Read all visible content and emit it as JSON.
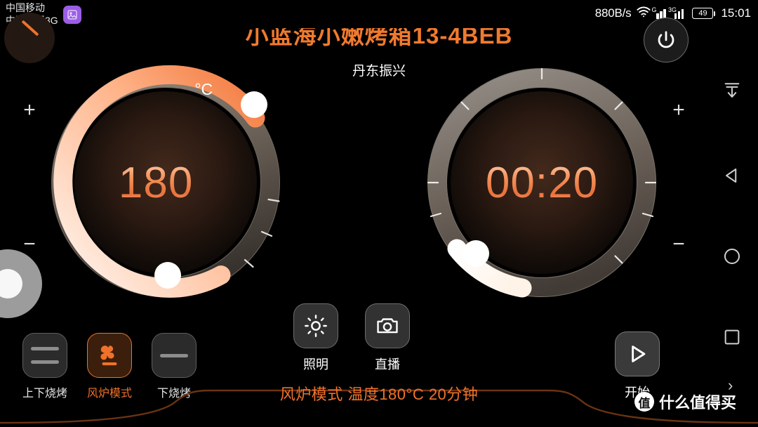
{
  "status_bar": {
    "carrier_line1": "中国移动",
    "carrier_line2": "中国联通3G",
    "app_badge_icon": "image-icon",
    "network_speed": "880B/s",
    "wifi_icon": "wifi-icon",
    "signal1_label": "G",
    "signal2_label": "3G",
    "battery_level": "49",
    "clock": "15:01"
  },
  "header": {
    "device_title": "小蓝海小嫩烤箱13-4BEB",
    "device_location": "丹东振兴",
    "power_icon": "power-icon",
    "title_color": "#f07a2e"
  },
  "temperature_dial": {
    "name": "temperature-dial",
    "value": "180",
    "unit": "°C",
    "increase_label": "+",
    "decrease_label": "−",
    "arc_color": "#f5835a",
    "progress_percent": 72
  },
  "timer_dial": {
    "name": "timer-dial",
    "value": "00:20",
    "increase_label": "+",
    "decrease_label": "−",
    "arc_color": "#ffffff",
    "progress_percent": 8
  },
  "center_actions": [
    {
      "id": "light",
      "label": "照明",
      "icon": "light-bulb-icon"
    },
    {
      "id": "live",
      "label": "直播",
      "icon": "camera-icon"
    }
  ],
  "modes": [
    {
      "id": "top-bottom-grill",
      "label": "上下烧烤",
      "icon": "two-bars-icon",
      "active": false
    },
    {
      "id": "fan-oven",
      "label": "风炉模式",
      "icon": "fan-icon",
      "active": true
    },
    {
      "id": "bottom-grill",
      "label": "下烧烤",
      "icon": "one-bar-icon",
      "active": false
    }
  ],
  "start_button": {
    "label": "开始",
    "icon": "play-icon"
  },
  "info_bar": {
    "text": "风炉模式  温度180°C  20分钟",
    "color": "#f0722a"
  },
  "nav_bar": [
    {
      "id": "download",
      "icon": "download-icon"
    },
    {
      "id": "back",
      "icon": "back-triangle-icon"
    },
    {
      "id": "home",
      "icon": "home-circle-icon"
    },
    {
      "id": "recents",
      "icon": "recents-square-icon"
    }
  ],
  "watermark": {
    "logo_char": "值",
    "text": "什么值得买",
    "arrow": "›"
  }
}
